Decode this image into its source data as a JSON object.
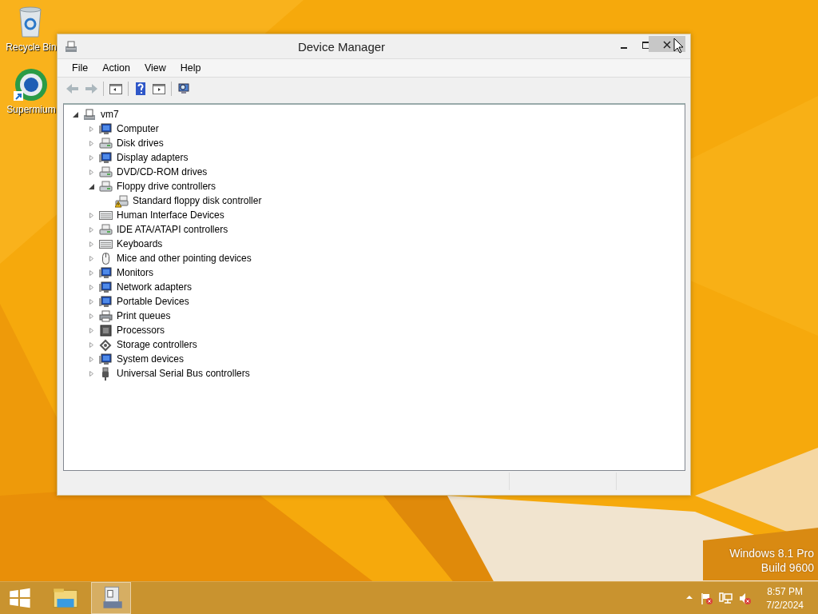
{
  "desktop_icons": [
    {
      "kind": "recycle",
      "label": "Recycle Bin"
    },
    {
      "kind": "browser",
      "label": "Supermium"
    }
  ],
  "window": {
    "title": "Device Manager",
    "controls": [
      {
        "kind": "minimize",
        "hovered": false
      },
      {
        "kind": "maximize",
        "hovered": false
      },
      {
        "kind": "close",
        "hovered": true
      }
    ],
    "menu": [
      "File",
      "Action",
      "View",
      "Help"
    ],
    "toolbar": [
      {
        "kind": "back",
        "disabled": true
      },
      {
        "kind": "forward",
        "disabled": true
      },
      {
        "kind": "separator"
      },
      {
        "kind": "tree-pane",
        "disabled": false
      },
      {
        "kind": "separator"
      },
      {
        "kind": "help",
        "disabled": false
      },
      {
        "kind": "action-pane",
        "disabled": false
      },
      {
        "kind": "separator"
      },
      {
        "kind": "scan",
        "disabled": false
      }
    ],
    "tree": [
      {
        "label": "vm7",
        "kind": "computer",
        "expanded": true,
        "children": [
          {
            "label": "Computer",
            "kind": "monitor",
            "expanded": false
          },
          {
            "label": "Disk drives",
            "kind": "drive",
            "expanded": false
          },
          {
            "label": "Display adapters",
            "kind": "monitor",
            "expanded": false
          },
          {
            "label": "DVD/CD-ROM drives",
            "kind": "drive",
            "expanded": false
          },
          {
            "label": "Floppy drive controllers",
            "kind": "drive",
            "expanded": true,
            "children": [
              {
                "label": "Standard floppy disk controller",
                "kind": "warning"
              }
            ]
          },
          {
            "label": "Human Interface Devices",
            "kind": "keyboard",
            "expanded": false
          },
          {
            "label": "IDE ATA/ATAPI controllers",
            "kind": "drive",
            "expanded": false
          },
          {
            "label": "Keyboards",
            "kind": "keyboard",
            "expanded": false
          },
          {
            "label": "Mice and other pointing devices",
            "kind": "mouse",
            "expanded": false
          },
          {
            "label": "Monitors",
            "kind": "monitor",
            "expanded": false
          },
          {
            "label": "Network adapters",
            "kind": "monitor",
            "expanded": false
          },
          {
            "label": "Portable Devices",
            "kind": "monitor",
            "expanded": false
          },
          {
            "label": "Print queues",
            "kind": "printer",
            "expanded": false
          },
          {
            "label": "Processors",
            "kind": "chip",
            "expanded": false
          },
          {
            "label": "Storage controllers",
            "kind": "storage",
            "expanded": false
          },
          {
            "label": "System devices",
            "kind": "monitor",
            "expanded": false
          },
          {
            "label": "Universal Serial Bus controllers",
            "kind": "usb",
            "expanded": false
          }
        ]
      }
    ]
  },
  "watermark": [
    "Windows 8.1 Pro",
    "Build 9600"
  ],
  "taskbar": {
    "apps": [
      {
        "kind": "start",
        "selected": false
      },
      {
        "kind": "explorer",
        "selected": false
      },
      {
        "kind": "device-manager",
        "selected": true
      }
    ],
    "tray": [
      {
        "kind": "show-hidden"
      },
      {
        "kind": "flag-error"
      },
      {
        "kind": "network"
      },
      {
        "kind": "volume-muted"
      }
    ],
    "time": "8:57 PM",
    "date": "7/2/2024"
  }
}
